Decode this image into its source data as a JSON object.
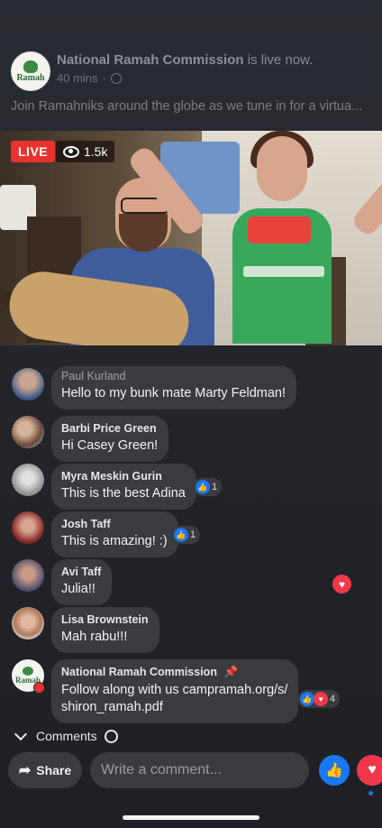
{
  "header": {
    "page_name": "National Ramah Commission",
    "status": " is live now.",
    "time": "40 mins",
    "description": "Join Ramahniks around the globe as we tune in for a virtua...",
    "logo_text": "Ramah"
  },
  "video": {
    "live_label": "LIVE",
    "viewer_count": "1.5k"
  },
  "comments": [
    {
      "name": "Paul Kurland",
      "text": "Hello to my bunk mate Marty Feldman!"
    },
    {
      "name": "Barbi Price Green",
      "text": "Hi Casey Green!"
    },
    {
      "name": "Myra Meskin Gurin",
      "text": "This is the best Adina",
      "likes": "1"
    },
    {
      "name": "Josh Taff",
      "text": "This is amazing! :)",
      "likes": "1"
    },
    {
      "name": "Avi Taff",
      "text": "Julia!!"
    },
    {
      "name": "Lisa Brownstein",
      "text": "Mah rabu!!!"
    },
    {
      "name": "National Ramah Commission",
      "text_line1": "Follow along with us campramah.org/s/",
      "text_line2": "shiron_ramah.pdf",
      "reactions": "4"
    }
  ],
  "comments_toggle": {
    "label": "Comments"
  },
  "composer": {
    "share_label": "Share",
    "placeholder": "Write a comment..."
  },
  "colors": {
    "accent": "#1877f2",
    "live": "#e8322e",
    "love": "#f0384a",
    "bubble": "#3a3b40"
  }
}
